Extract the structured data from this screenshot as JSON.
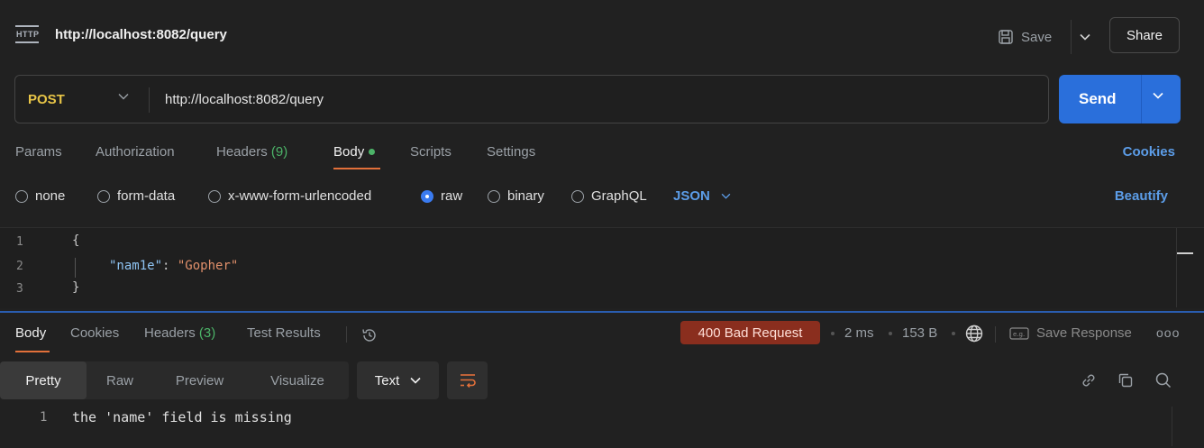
{
  "titlebar": {
    "icon": "http-icon",
    "title": "http://localhost:8082/query",
    "save_label": "Save",
    "share_label": "Share"
  },
  "request": {
    "method": "POST",
    "url": "http://localhost:8082/query",
    "send_label": "Send"
  },
  "request_tabs": {
    "params": "Params",
    "authorization": "Authorization",
    "headers": "Headers",
    "headers_count": "(9)",
    "body": "Body",
    "scripts": "Scripts",
    "settings": "Settings",
    "cookies": "Cookies"
  },
  "body_types": {
    "none": "none",
    "form_data": "form-data",
    "urlencoded": "x-www-form-urlencoded",
    "raw": "raw",
    "binary": "binary",
    "graphql": "GraphQL",
    "language": "JSON",
    "beautify": "Beautify",
    "selected": "raw"
  },
  "editor": {
    "lines": [
      {
        "num": "1",
        "text": "{"
      },
      {
        "num": "2",
        "key": "\"nam1e\"",
        "colon": ": ",
        "value": "\"Gopher\""
      },
      {
        "num": "3",
        "text": "}"
      }
    ]
  },
  "response_tabs": {
    "body": "Body",
    "cookies": "Cookies",
    "headers": "Headers",
    "headers_count": "(3)",
    "test_results": "Test Results"
  },
  "response_meta": {
    "status": "400 Bad Request",
    "time": "2 ms",
    "size": "153 B",
    "save_response": "Save Response",
    "more": "ooo"
  },
  "response_toolbar": {
    "pretty": "Pretty",
    "raw": "Raw",
    "preview": "Preview",
    "visualize": "Visualize",
    "format": "Text"
  },
  "response_body": {
    "line_num": "1",
    "text": "the 'name' field is missing"
  },
  "colors": {
    "accent": "#e2703a",
    "send": "#2a6fdb",
    "link": "#5c9de8",
    "method": "#e8c547",
    "error_badge": "#8a2e1e",
    "green": "#4cb368"
  }
}
